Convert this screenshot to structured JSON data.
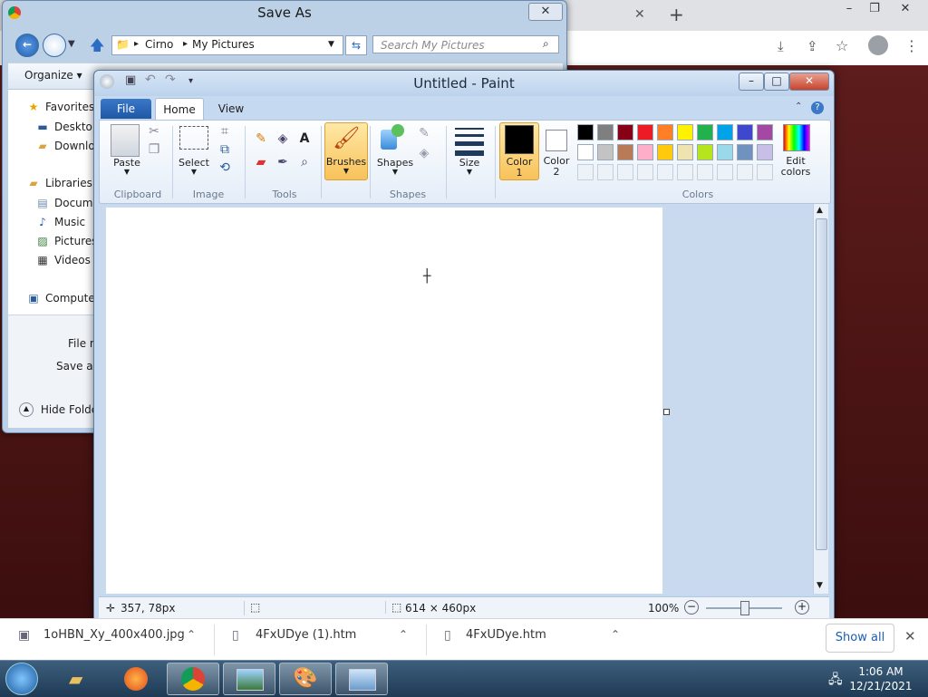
{
  "chrome": {
    "win_controls": [
      "–",
      "❐",
      "✕"
    ],
    "tab_close": "✕",
    "new_tab": "+"
  },
  "saveas": {
    "title": "Save As",
    "close": "✕",
    "breadcrumb": [
      "Cirno",
      "My Pictures"
    ],
    "search_placeholder": "Search My Pictures",
    "organize": "Organize ▾",
    "tree": {
      "favorites": "Favorites",
      "desktop": "Desktop",
      "downloads": "Downloa",
      "libraries": "Libraries",
      "documents": "Docume",
      "music": "Music",
      "pictures": "Pictures",
      "videos": "Videos",
      "computer": "Computer"
    },
    "file_name_label": "File n",
    "save_as_label": "Save as",
    "hide_folders": "Hide Folder"
  },
  "paint": {
    "title": "Untitled - Paint",
    "tabs": {
      "file": "File",
      "home": "Home",
      "view": "View"
    },
    "groups": {
      "clipboard": "Clipboard",
      "image": "Image",
      "tools": "Tools",
      "shapes": "Shapes",
      "colors": "Colors"
    },
    "buttons": {
      "paste": "Paste",
      "select": "Select",
      "brushes": "Brushes",
      "shapes": "Shapes",
      "size": "Size",
      "color1": "Color",
      "color1_num": "1",
      "color2": "Color",
      "color2_num": "2",
      "edit_colors": "Edit",
      "edit_colors_2": "colors"
    },
    "palette_row1": [
      "#000000",
      "#7f7f7f",
      "#880015",
      "#ed1c24",
      "#ff7f27",
      "#fff200",
      "#22b14c",
      "#00a2e8",
      "#3f48cc",
      "#a349a4"
    ],
    "palette_row2": [
      "#ffffff",
      "#c3c3c3",
      "#b97a57",
      "#ffaec9",
      "#ffc90e",
      "#efe4b0",
      "#b5e61d",
      "#99d9ea",
      "#7092be",
      "#c8bfe7"
    ],
    "status": {
      "cursor_pos": "357, 78px",
      "canvas_size": "614 × 460px",
      "zoom": "100%"
    }
  },
  "downloads": {
    "items": [
      "1oHBN_Xy_400x400.jpg",
      "4FxUDye (1).htm",
      "4FxUDye.htm"
    ],
    "show_all": "Show all",
    "close": "✕"
  },
  "taskbar": {
    "time": "1:06 AM",
    "date": "12/21/2021"
  }
}
